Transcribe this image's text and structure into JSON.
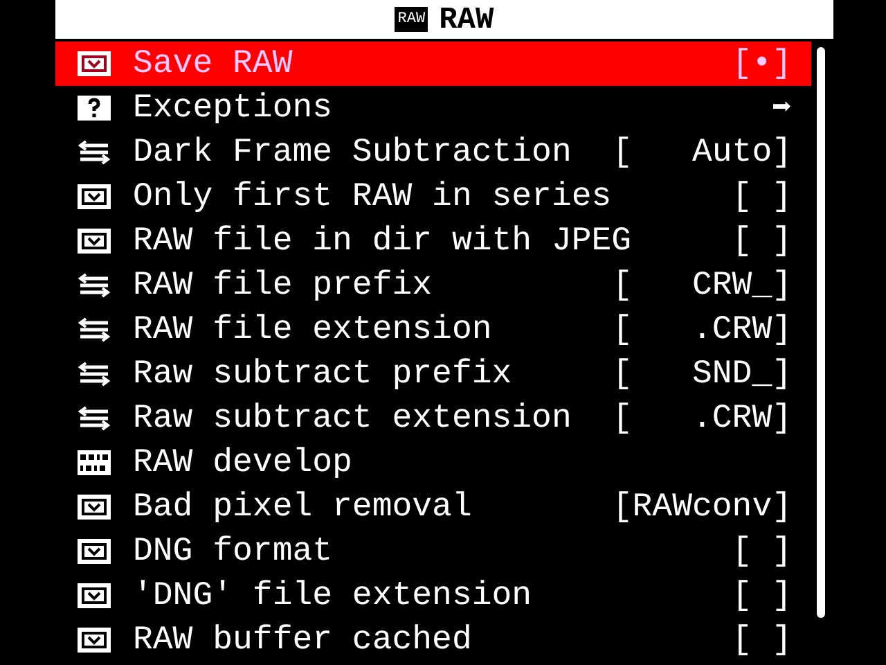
{
  "title": {
    "badge": "RAW",
    "text": "RAW"
  },
  "items": [
    {
      "kind": "checkbox",
      "label": "Save RAW",
      "value": "[•]",
      "selected": true
    },
    {
      "kind": "submenu",
      "label": "Exceptions",
      "value": "➡",
      "selected": false
    },
    {
      "kind": "enum",
      "label": "Dark Frame Subtraction",
      "value": "[   Auto]",
      "selected": false
    },
    {
      "kind": "checkbox",
      "label": "Only first RAW in series",
      "value": "[ ]",
      "selected": false
    },
    {
      "kind": "checkbox",
      "label": "RAW file in dir with JPEG",
      "value": "[ ]",
      "selected": false
    },
    {
      "kind": "enum",
      "label": "RAW file prefix",
      "value": "[   CRW_]",
      "selected": false
    },
    {
      "kind": "enum",
      "label": "RAW file extension",
      "value": "[   .CRW]",
      "selected": false
    },
    {
      "kind": "enum",
      "label": "Raw subtract prefix",
      "value": "[   SND_]",
      "selected": false
    },
    {
      "kind": "enum",
      "label": "Raw subtract extension",
      "value": "[   .CRW]",
      "selected": false
    },
    {
      "kind": "group",
      "label": "RAW develop",
      "selected": false
    },
    {
      "kind": "checkbox",
      "label": "Bad pixel removal",
      "value": "[RAWconv]",
      "selected": false
    },
    {
      "kind": "checkbox",
      "label": "DNG format",
      "value": "[ ]",
      "selected": false
    },
    {
      "kind": "checkbox",
      "label": "'DNG' file extension",
      "value": "[ ]",
      "selected": false
    },
    {
      "kind": "checkbox",
      "label": "RAW buffer cached",
      "value": "[ ]",
      "selected": false
    }
  ]
}
